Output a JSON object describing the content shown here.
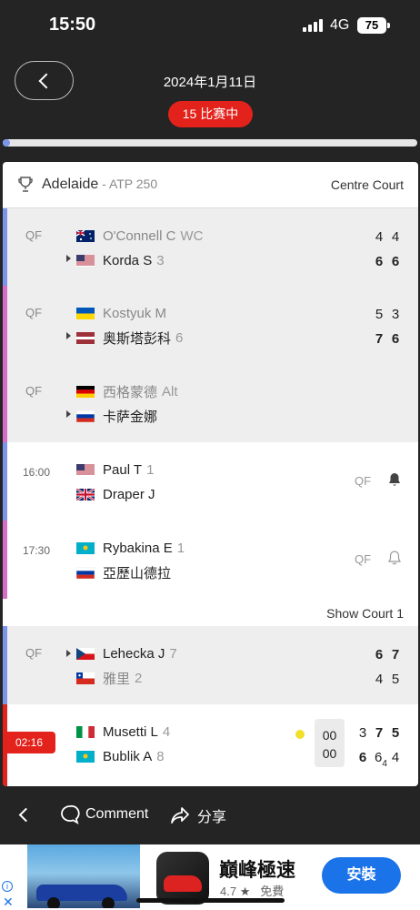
{
  "status": {
    "time": "15:50",
    "network": "4G",
    "battery": "75"
  },
  "header": {
    "date": "2024年1月11日",
    "live_count": "15 比赛中"
  },
  "tournament": {
    "name": "Adelaide",
    "category": " - ATP 250",
    "court": "Centre Court",
    "court2": "Show Court 1"
  },
  "matches": [
    {
      "round": "QF",
      "p1": {
        "flag": "flag-australia",
        "name": "O'Connell C",
        "seed": "WC"
      },
      "p2": {
        "flag": "flag-usa",
        "name": "Korda S",
        "seed": "3"
      },
      "s1": [
        "4",
        "4"
      ],
      "s2": [
        "6",
        "6"
      ]
    },
    {
      "round": "QF",
      "p1": {
        "flag": "flag-ukraine",
        "name": "Kostyuk M",
        "seed": ""
      },
      "p2": {
        "flag": "flag-latvia",
        "name": "奥斯塔彭科",
        "seed": "6"
      },
      "s1": [
        "5",
        "3"
      ],
      "s2": [
        "7",
        "6"
      ]
    },
    {
      "round": "QF",
      "p1": {
        "flag": "flag-germany",
        "name": "西格蒙德",
        "seed": "Alt"
      },
      "p2": {
        "flag": "flag-russia",
        "name": "卡萨金娜",
        "seed": ""
      }
    },
    {
      "time": "16:00",
      "round_right": "QF",
      "p1": {
        "flag": "flag-usa",
        "name": "Paul T",
        "seed": "1"
      },
      "p2": {
        "flag": "flag-uk",
        "name": "Draper J",
        "seed": ""
      }
    },
    {
      "time": "17:30",
      "round_right": "QF",
      "p1": {
        "flag": "flag-kazakhstan",
        "name": "Rybakina E",
        "seed": "1"
      },
      "p2": {
        "flag": "flag-russia",
        "name": "亞歷山德拉",
        "seed": ""
      }
    },
    {
      "round": "QF",
      "p1": {
        "flag": "flag-czech",
        "name": "Lehecka J",
        "seed": "7"
      },
      "p2": {
        "flag": "flag-chile",
        "name": "雅里",
        "seed": "2"
      },
      "s1": [
        "6",
        "7"
      ],
      "s2": [
        "4",
        "5"
      ]
    },
    {
      "live_time": "02:16",
      "p1": {
        "flag": "flag-italy",
        "name": "Musetti L",
        "seed": "4"
      },
      "p2": {
        "flag": "flag-kazakhstan",
        "name": "Bublik A",
        "seed": "8"
      },
      "game1": "00",
      "game2": "00",
      "s1": [
        "3",
        "7",
        "5"
      ],
      "s2": [
        "6",
        "6",
        "4"
      ],
      "tiebreak": "4"
    }
  ],
  "bottom_bar": {
    "comment": "Comment",
    "share": "分享"
  },
  "ad": {
    "title": "巔峰極速",
    "rating": "4.7",
    "price": "免費",
    "install": "安裝"
  },
  "colors": {
    "accent_red": "#e3221b",
    "stripe_blue": "#7b96e8",
    "stripe_pink": "#d56fc3",
    "ad_blue": "#1a73e8"
  }
}
